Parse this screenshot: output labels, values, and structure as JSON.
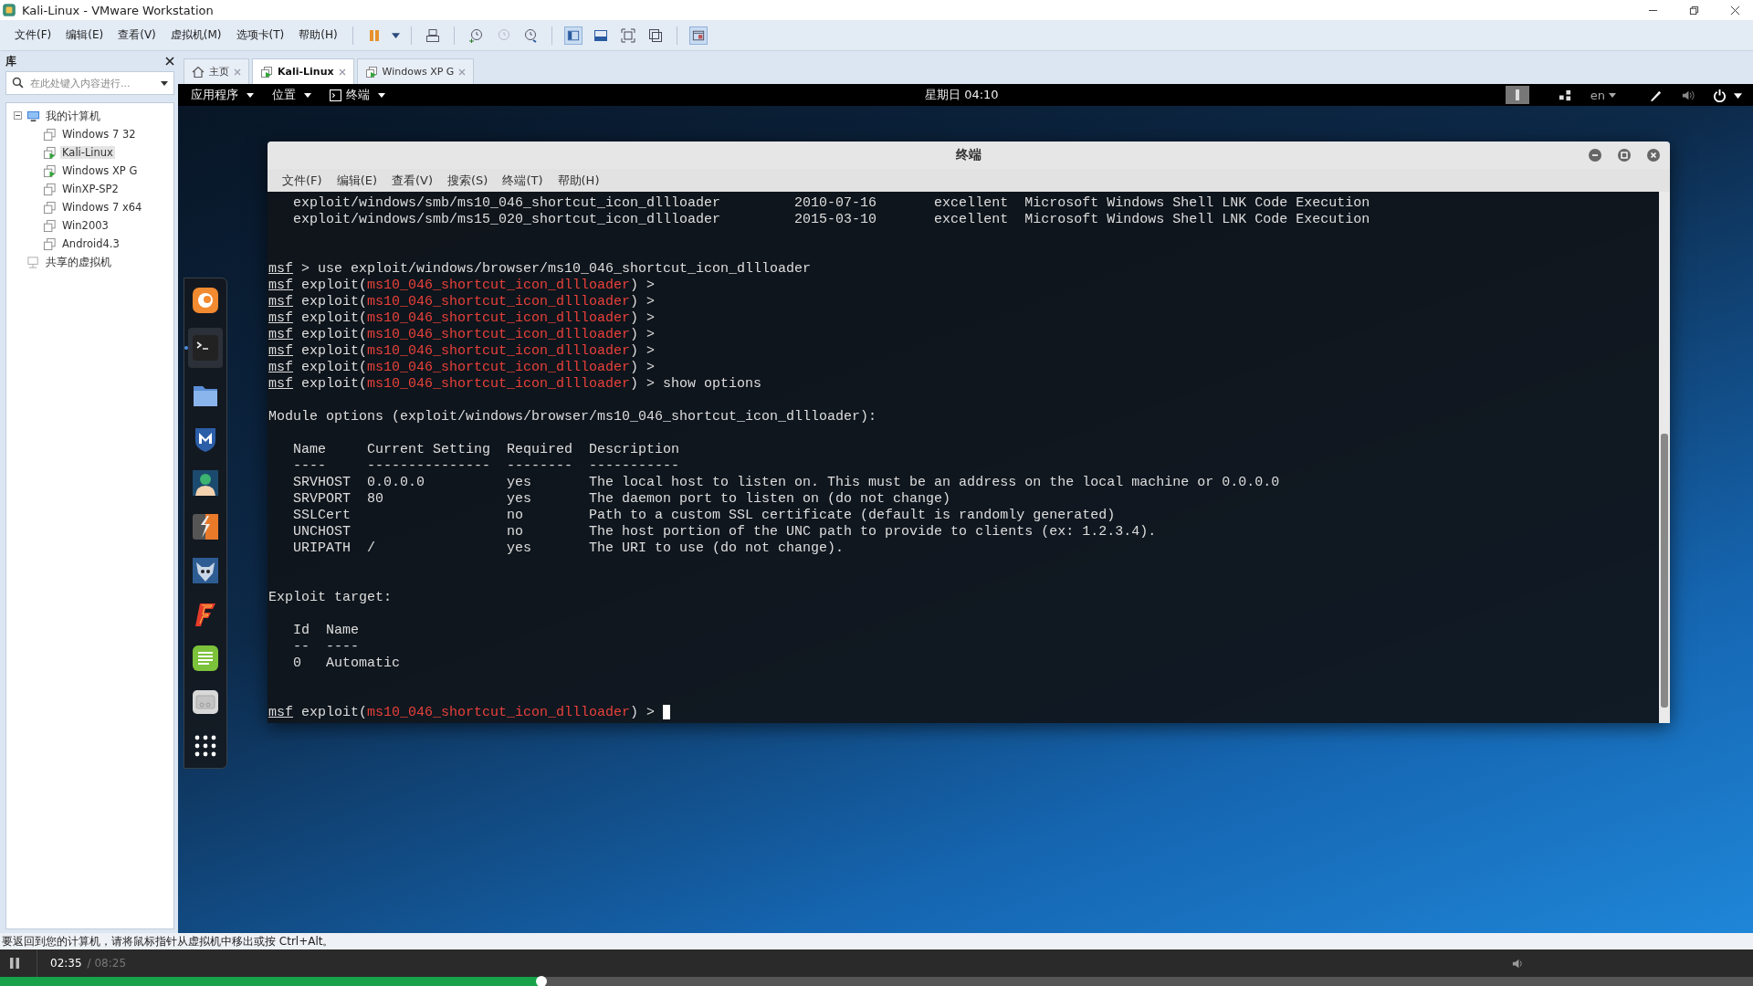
{
  "window": {
    "title": "Kali-Linux - VMware Workstation"
  },
  "menu": [
    "文件(F)",
    "编辑(E)",
    "查看(V)",
    "虚拟机(M)",
    "选项卡(T)",
    "帮助(H)"
  ],
  "library": {
    "title": "库",
    "search": {
      "placeholder": "在此处键入内容进行..."
    },
    "tree": [
      {
        "label": "我的计算机",
        "kind": "computer",
        "expanded": true,
        "children": [
          {
            "label": "Windows 7 32",
            "running": false,
            "selected": false
          },
          {
            "label": "Kali-Linux",
            "running": true,
            "selected": true
          },
          {
            "label": "Windows XP G",
            "running": true,
            "selected": false
          },
          {
            "label": "WinXP-SP2",
            "running": false,
            "selected": false
          },
          {
            "label": "Windows 7 x64",
            "running": false,
            "selected": false
          },
          {
            "label": "Win2003",
            "running": false,
            "selected": false
          },
          {
            "label": "Android4.3",
            "running": false,
            "selected": false
          }
        ]
      },
      {
        "label": "共享的虚拟机",
        "kind": "shared"
      }
    ]
  },
  "tabs": [
    {
      "label": "主页",
      "kind": "home",
      "selected": false
    },
    {
      "label": "Kali-Linux",
      "kind": "vm",
      "selected": true
    },
    {
      "label": "Windows XP G",
      "kind": "vm",
      "selected": false
    }
  ],
  "kali": {
    "top_bar": {
      "menus": [
        {
          "label": "应用程序",
          "kind": "menu"
        },
        {
          "label": "位置",
          "kind": "menu"
        },
        {
          "label": "终端",
          "kind": "terminal"
        }
      ],
      "clock": "星期日 04:10",
      "language": "en"
    },
    "dock": [
      {
        "kind": "browser",
        "selected": false
      },
      {
        "kind": "terminal",
        "selected": true
      },
      {
        "kind": "folder",
        "selected": false
      },
      {
        "kind": "shield",
        "selected": false
      },
      {
        "kind": "person",
        "selected": false
      },
      {
        "kind": "bolt",
        "selected": false
      },
      {
        "kind": "wolf",
        "selected": false
      },
      {
        "kind": "flame",
        "selected": false
      },
      {
        "kind": "notes",
        "selected": false
      },
      {
        "kind": "drive",
        "selected": false
      },
      {
        "kind": "apps",
        "selected": false
      }
    ],
    "terminal": {
      "title": "终端",
      "menu": [
        "文件(F)",
        "编辑(E)",
        "查看(V)",
        "搜索(S)",
        "终端(T)",
        "帮助(H)"
      ],
      "lines": [
        {
          "kind": "text",
          "text": "   exploit/windows/smb/ms10_046_shortcut_icon_dllloader         2010-07-16       excellent  Microsoft Windows Shell LNK Code Execution"
        },
        {
          "kind": "text",
          "text": "   exploit/windows/smb/ms15_020_shortcut_icon_dllloader         2015-03-10       excellent  Microsoft Windows Shell LNK Code Execution"
        },
        {
          "kind": "blank"
        },
        {
          "kind": "blank"
        },
        {
          "kind": "prompt",
          "segments": [
            {
              "text": "msf",
              "kind": "user"
            },
            {
              "text": " > use exploit/windows/browser/ms10_046_shortcut_icon_dllloader",
              "kind": "text"
            }
          ]
        },
        {
          "kind": "prompt",
          "segments": [
            {
              "text": "msf",
              "kind": "user"
            },
            {
              "text": " exploit(",
              "kind": "text"
            },
            {
              "text": "ms10_046_shortcut_icon_dllloader",
              "kind": "module"
            },
            {
              "text": ") >",
              "kind": "text"
            }
          ]
        },
        {
          "kind": "prompt",
          "segments": [
            {
              "text": "msf",
              "kind": "user"
            },
            {
              "text": " exploit(",
              "kind": "text"
            },
            {
              "text": "ms10_046_shortcut_icon_dllloader",
              "kind": "module"
            },
            {
              "text": ") >",
              "kind": "text"
            }
          ]
        },
        {
          "kind": "prompt",
          "segments": [
            {
              "text": "msf",
              "kind": "user"
            },
            {
              "text": " exploit(",
              "kind": "text"
            },
            {
              "text": "ms10_046_shortcut_icon_dllloader",
              "kind": "module"
            },
            {
              "text": ") >",
              "kind": "text"
            }
          ]
        },
        {
          "kind": "prompt",
          "segments": [
            {
              "text": "msf",
              "kind": "user"
            },
            {
              "text": " exploit(",
              "kind": "text"
            },
            {
              "text": "ms10_046_shortcut_icon_dllloader",
              "kind": "module"
            },
            {
              "text": ") >",
              "kind": "text"
            }
          ]
        },
        {
          "kind": "prompt",
          "segments": [
            {
              "text": "msf",
              "kind": "user"
            },
            {
              "text": " exploit(",
              "kind": "text"
            },
            {
              "text": "ms10_046_shortcut_icon_dllloader",
              "kind": "module"
            },
            {
              "text": ") >",
              "kind": "text"
            }
          ]
        },
        {
          "kind": "prompt",
          "segments": [
            {
              "text": "msf",
              "kind": "user"
            },
            {
              "text": " exploit(",
              "kind": "text"
            },
            {
              "text": "ms10_046_shortcut_icon_dllloader",
              "kind": "module"
            },
            {
              "text": ") >",
              "kind": "text"
            }
          ]
        },
        {
          "kind": "prompt",
          "segments": [
            {
              "text": "msf",
              "kind": "user"
            },
            {
              "text": " exploit(",
              "kind": "text"
            },
            {
              "text": "ms10_046_shortcut_icon_dllloader",
              "kind": "module"
            },
            {
              "text": ") > show options",
              "kind": "text"
            }
          ]
        },
        {
          "kind": "blank"
        },
        {
          "kind": "text",
          "text": "Module options (exploit/windows/browser/ms10_046_shortcut_icon_dllloader):"
        },
        {
          "kind": "blank"
        },
        {
          "kind": "text",
          "text": "   Name     Current Setting  Required  Description"
        },
        {
          "kind": "text",
          "text": "   ----     ---------------  --------  -----------"
        },
        {
          "kind": "text",
          "text": "   SRVHOST  0.0.0.0          yes       The local host to listen on. This must be an address on the local machine or 0.0.0.0"
        },
        {
          "kind": "text",
          "text": "   SRVPORT  80               yes       The daemon port to listen on (do not change)"
        },
        {
          "kind": "text",
          "text": "   SSLCert                   no        Path to a custom SSL certificate (default is randomly generated)"
        },
        {
          "kind": "text",
          "text": "   UNCHOST                   no        The host portion of the UNC path to provide to clients (ex: 1.2.3.4)."
        },
        {
          "kind": "text",
          "text": "   URIPATH  /                yes       The URI to use (do not change)."
        },
        {
          "kind": "blank"
        },
        {
          "kind": "blank"
        },
        {
          "kind": "text",
          "text": "Exploit target:"
        },
        {
          "kind": "blank"
        },
        {
          "kind": "text",
          "text": "   Id  Name"
        },
        {
          "kind": "text",
          "text": "   --  ----"
        },
        {
          "kind": "text",
          "text": "   0   Automatic"
        },
        {
          "kind": "blank"
        },
        {
          "kind": "blank"
        },
        {
          "kind": "prompt",
          "cursor": true,
          "segments": [
            {
              "text": "msf",
              "kind": "user"
            },
            {
              "text": " exploit(",
              "kind": "text"
            },
            {
              "text": "ms10_046_shortcut_icon_dllloader",
              "kind": "module"
            },
            {
              "text": ") >",
              "kind": "text"
            }
          ]
        }
      ]
    }
  },
  "status": "要返回到您的计算机，请将鼠标指针从虚拟机中移出或按 Ctrl+Alt。",
  "player": {
    "playing": true,
    "elapsed": "02:35",
    "duration": "/ 08:25",
    "level": 0.309
  }
}
